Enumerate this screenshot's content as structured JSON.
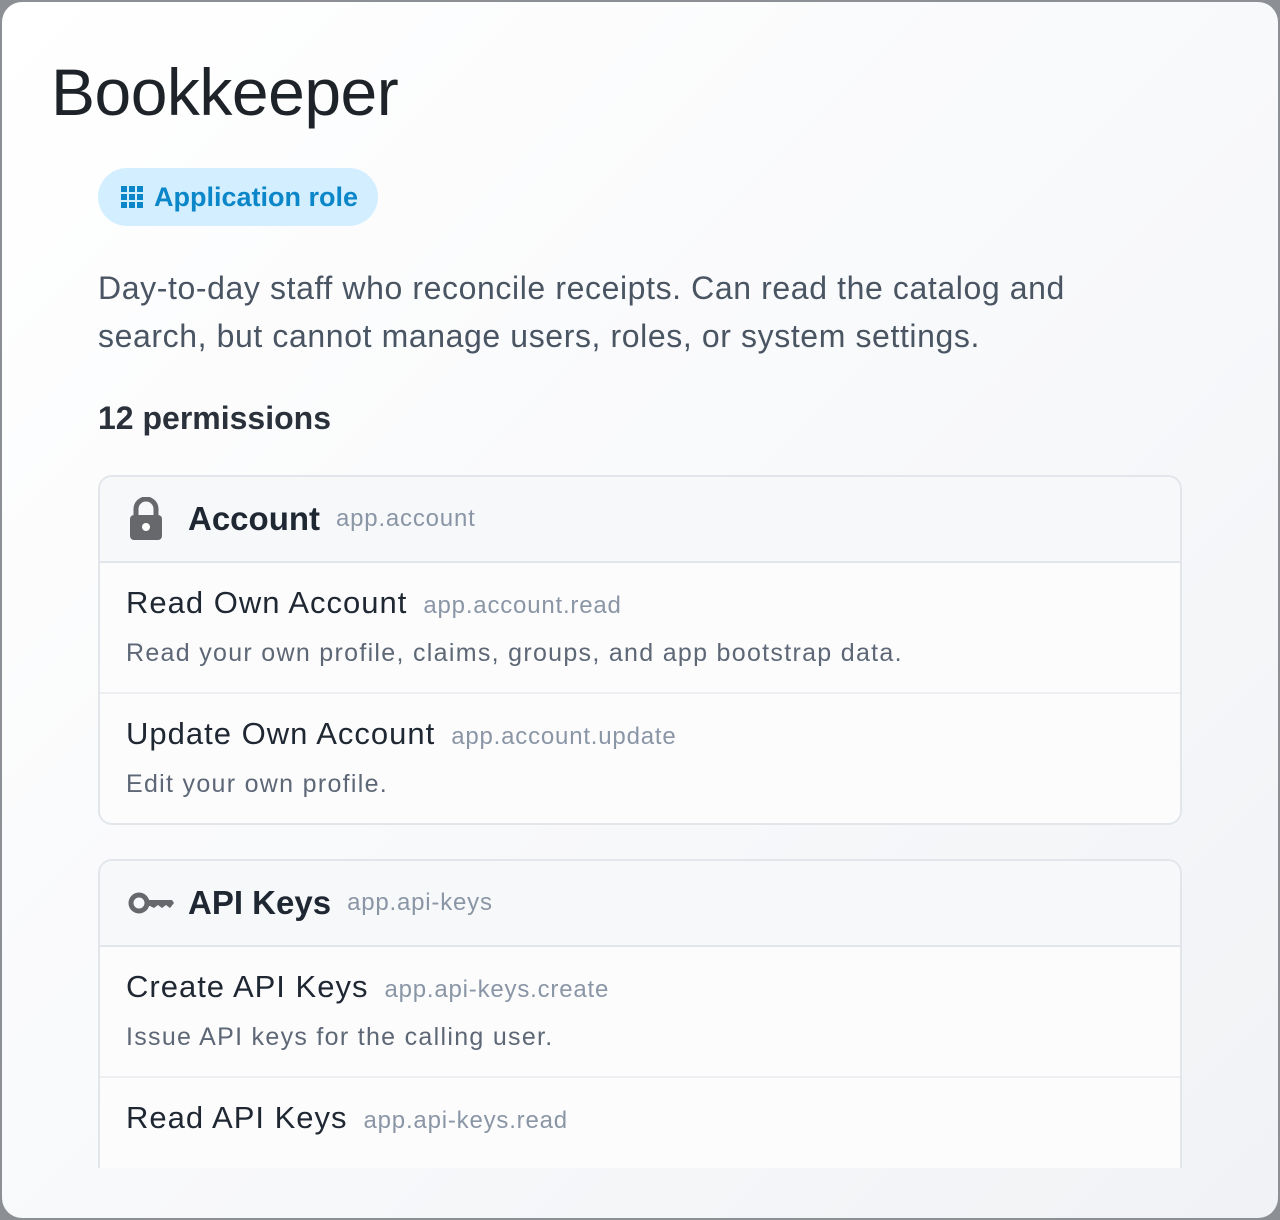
{
  "title": "Bookkeeper",
  "badge": {
    "label": "Application role",
    "icon": "grid-icon",
    "color": "#0b86c9",
    "background": "#d3efff"
  },
  "description": "Day-to-day staff who reconcile receipts. Can read the catalog and search, but cannot manage users, roles, or system settings.",
  "permission_count": "12 permissions",
  "groups": [
    {
      "name": "Account",
      "code": "app.account",
      "icon": "lock-icon",
      "permissions": [
        {
          "name": "Read Own Account",
          "code": "app.account.read",
          "description": "Read your own profile, claims, groups, and app bootstrap data."
        },
        {
          "name": "Update Own Account",
          "code": "app.account.update",
          "description": "Edit your own profile."
        }
      ]
    },
    {
      "name": "API Keys",
      "code": "app.api-keys",
      "icon": "key-icon",
      "permissions": [
        {
          "name": "Create API Keys",
          "code": "app.api-keys.create",
          "description": "Issue API keys for the calling user."
        },
        {
          "name": "Read API Keys",
          "code": "app.api-keys.read",
          "description": ""
        }
      ]
    }
  ]
}
